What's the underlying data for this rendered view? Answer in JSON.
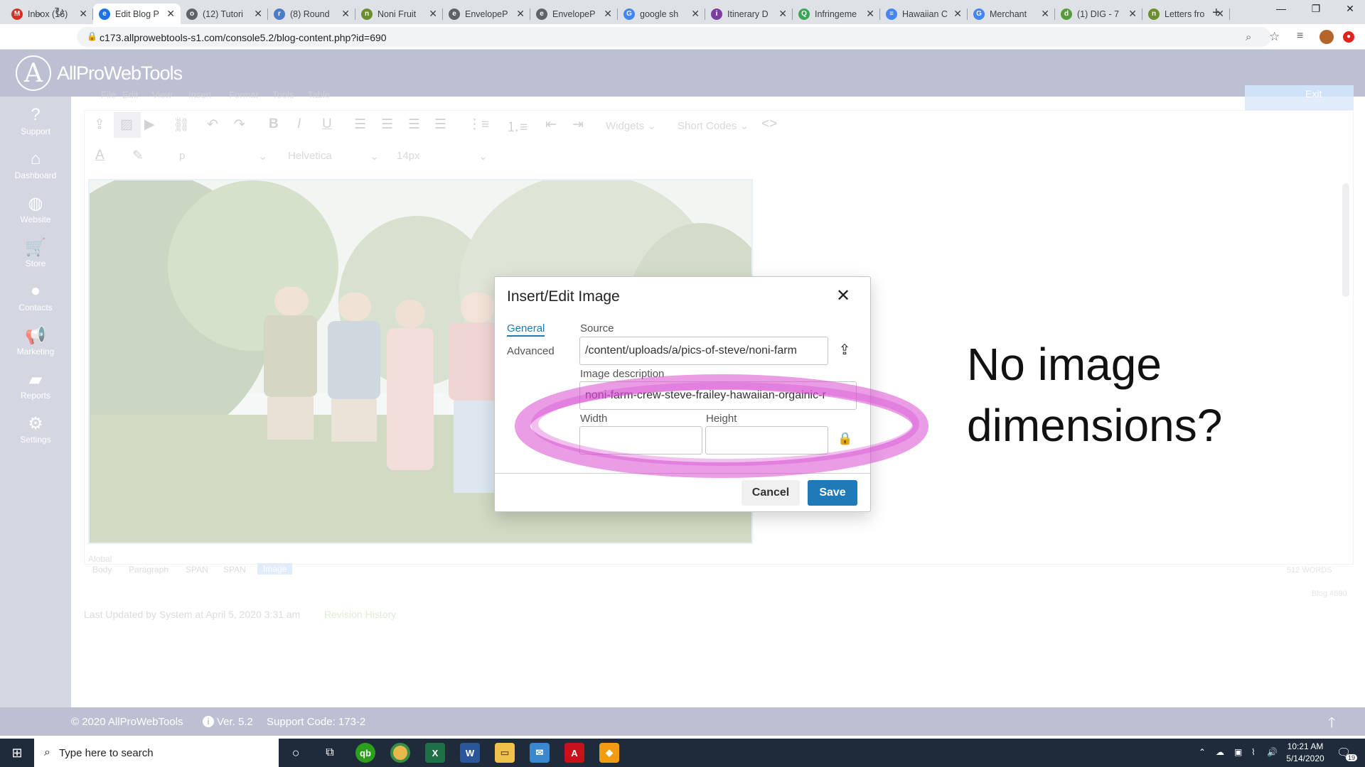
{
  "browser": {
    "tabs": [
      {
        "label": "Inbox (16)",
        "color": "#d93025",
        "glyph": "M"
      },
      {
        "label": "Edit Blog P",
        "color": "#1a73e8",
        "glyph": "e",
        "active": true
      },
      {
        "label": "(12) Tutori",
        "color": "#5f6368",
        "glyph": "o"
      },
      {
        "label": "(8) Round",
        "color": "#4a7cc9",
        "glyph": "r"
      },
      {
        "label": "Noni Fruit",
        "color": "#6a8f2d",
        "glyph": "n"
      },
      {
        "label": "EnvelopeP",
        "color": "#5f6368",
        "glyph": "e"
      },
      {
        "label": "EnvelopeP",
        "color": "#5f6368",
        "glyph": "e"
      },
      {
        "label": "google sh",
        "color": "#4285f4",
        "glyph": "G"
      },
      {
        "label": "Itinerary D",
        "color": "#7b3fa0",
        "glyph": "i"
      },
      {
        "label": "Infringeme",
        "color": "#3aa757",
        "glyph": "Q"
      },
      {
        "label": "Hawaiian C",
        "color": "#4285f4",
        "glyph": "≡"
      },
      {
        "label": "Merchant",
        "color": "#4285f4",
        "glyph": "G"
      },
      {
        "label": "(1) DIG - 7",
        "color": "#5a9a3c",
        "glyph": "d"
      },
      {
        "label": "Letters fro",
        "color": "#6a8f2d",
        "glyph": "n"
      }
    ],
    "close_glyph": "✕",
    "new_tab": "+",
    "url": "c173.allprowebtools-s1.com/console5.2/blog-content.php?id=690"
  },
  "app": {
    "logo_letter": "A",
    "brand": "AllProWebTools"
  },
  "sidebar": {
    "items": [
      {
        "label": "Support",
        "icon": "question-icon",
        "glyph": "?"
      },
      {
        "label": "Dashboard",
        "icon": "home-icon",
        "glyph": "⌂"
      },
      {
        "label": "Website",
        "icon": "globe-icon",
        "glyph": "◍"
      },
      {
        "label": "Store",
        "icon": "cart-icon",
        "glyph": "🛒"
      },
      {
        "label": "Contacts",
        "icon": "person-icon",
        "glyph": "●"
      },
      {
        "label": "Marketing",
        "icon": "megaphone-icon",
        "glyph": "📢"
      },
      {
        "label": "Reports",
        "icon": "folder-icon",
        "glyph": "▰"
      },
      {
        "label": "Settings",
        "icon": "gear-icon",
        "glyph": "⚙"
      }
    ]
  },
  "editor": {
    "menu": [
      "File",
      "Edit",
      "View",
      "Insert",
      "Format",
      "Tools",
      "Table"
    ],
    "widgets_label": "Widgets",
    "shortcodes_label": "Short Codes",
    "block_format": "p",
    "font_family": "Helvetica",
    "font_size": "14px",
    "path_prefix": "Alobal",
    "breadcrumbs": [
      "Body",
      "Paragraph",
      "SPAN",
      "SPAN",
      "Image"
    ],
    "word_count": "512 WORDS",
    "exit_label": "Exit",
    "blog_id": "Blog #690",
    "last_updated": "Last Updated by System at April 5, 2020 3:31 am",
    "revision_link": "Revision History"
  },
  "dialog": {
    "title": "Insert/Edit Image",
    "close": "✕",
    "tabs": [
      "General",
      "Advanced"
    ],
    "source_label": "Source",
    "source_value": "/content/uploads/a/pics-of-steve/noni-farm",
    "description_label": "Image description",
    "description_value": "noni-farm-crew-steve-frailey-hawaiian-orgainic-r",
    "width_label": "Width",
    "width_value": "",
    "height_label": "Height",
    "height_value": "",
    "cancel": "Cancel",
    "save": "Save"
  },
  "annotation": {
    "line1": "No image",
    "line2": "dimensions?",
    "highlight_color": "#d84ad0"
  },
  "footer": {
    "copyright": "© 2020 AllProWebTools",
    "version": "Ver. 5.2",
    "support_code": "Support Code: 173-2"
  },
  "taskbar": {
    "search_placeholder": "Type here to search",
    "time": "10:21 AM",
    "date": "5/14/2020",
    "notifications": "19"
  }
}
